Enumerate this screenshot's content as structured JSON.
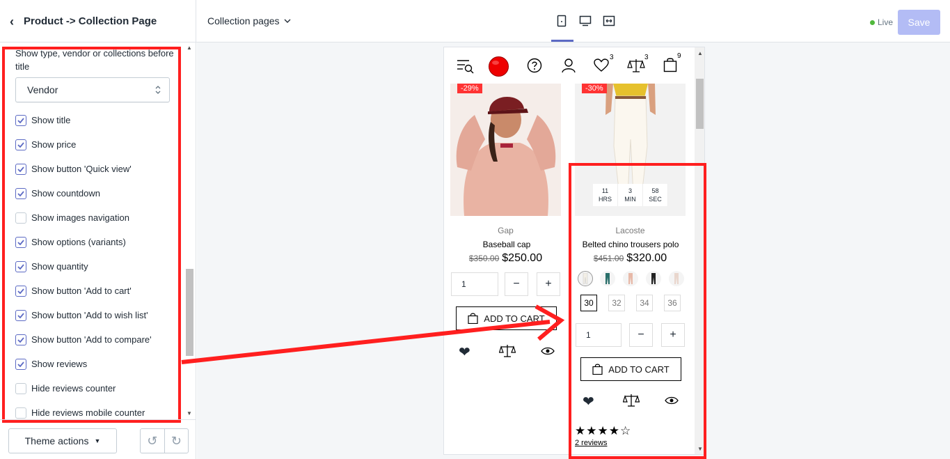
{
  "header": {
    "back_label": "Product -> Collection Page",
    "page_select": "Collection pages",
    "live": "Live",
    "save": "Save"
  },
  "sidebar": {
    "vendor_label": "Show type, vendor or collections before title",
    "vendor_select": "Vendor",
    "options": [
      {
        "label": "Show title",
        "checked": true
      },
      {
        "label": "Show price",
        "checked": true
      },
      {
        "label": "Show button 'Quick view'",
        "checked": true
      },
      {
        "label": "Show countdown",
        "checked": true
      },
      {
        "label": "Show images navigation",
        "checked": false
      },
      {
        "label": "Show options (variants)",
        "checked": true
      },
      {
        "label": "Show quantity",
        "checked": true
      },
      {
        "label": "Show button 'Add to cart'",
        "checked": true
      },
      {
        "label": "Show button 'Add to wish list'",
        "checked": true
      },
      {
        "label": "Show button 'Add to compare'",
        "checked": true
      },
      {
        "label": "Show reviews",
        "checked": true
      },
      {
        "label": "Hide reviews counter",
        "checked": false
      },
      {
        "label": "Hide reviews mobile counter",
        "checked": false
      }
    ],
    "theme_actions": "Theme actions"
  },
  "preview": {
    "badges": {
      "wishlist": "3",
      "compare": "3",
      "cart": "9"
    },
    "products": [
      {
        "sale": "-29%",
        "vendor": "Gap",
        "name": "Baseball cap",
        "old_price": "$350.00",
        "price": "$250.00",
        "qty": "1",
        "add_to_cart": "ADD TO CART"
      },
      {
        "sale": "-30%",
        "vendor": "Lacoste",
        "name": "Belted chino trousers polo",
        "old_price": "$451.00",
        "price": "$320.00",
        "qty": "1",
        "add_to_cart": "ADD TO CART",
        "countdown": [
          {
            "value": "11",
            "unit": "HRS"
          },
          {
            "value": "3",
            "unit": "MIN"
          },
          {
            "value": "58",
            "unit": "SEC"
          }
        ],
        "sizes": [
          "30",
          "32",
          "34",
          "36"
        ],
        "rating": 4,
        "stars": "★★★★☆",
        "reviews": "2 reviews"
      }
    ]
  },
  "colors": {
    "accent": "#5c6ac4",
    "highlight": "#ff1f1f",
    "sale": "#ff3333"
  }
}
